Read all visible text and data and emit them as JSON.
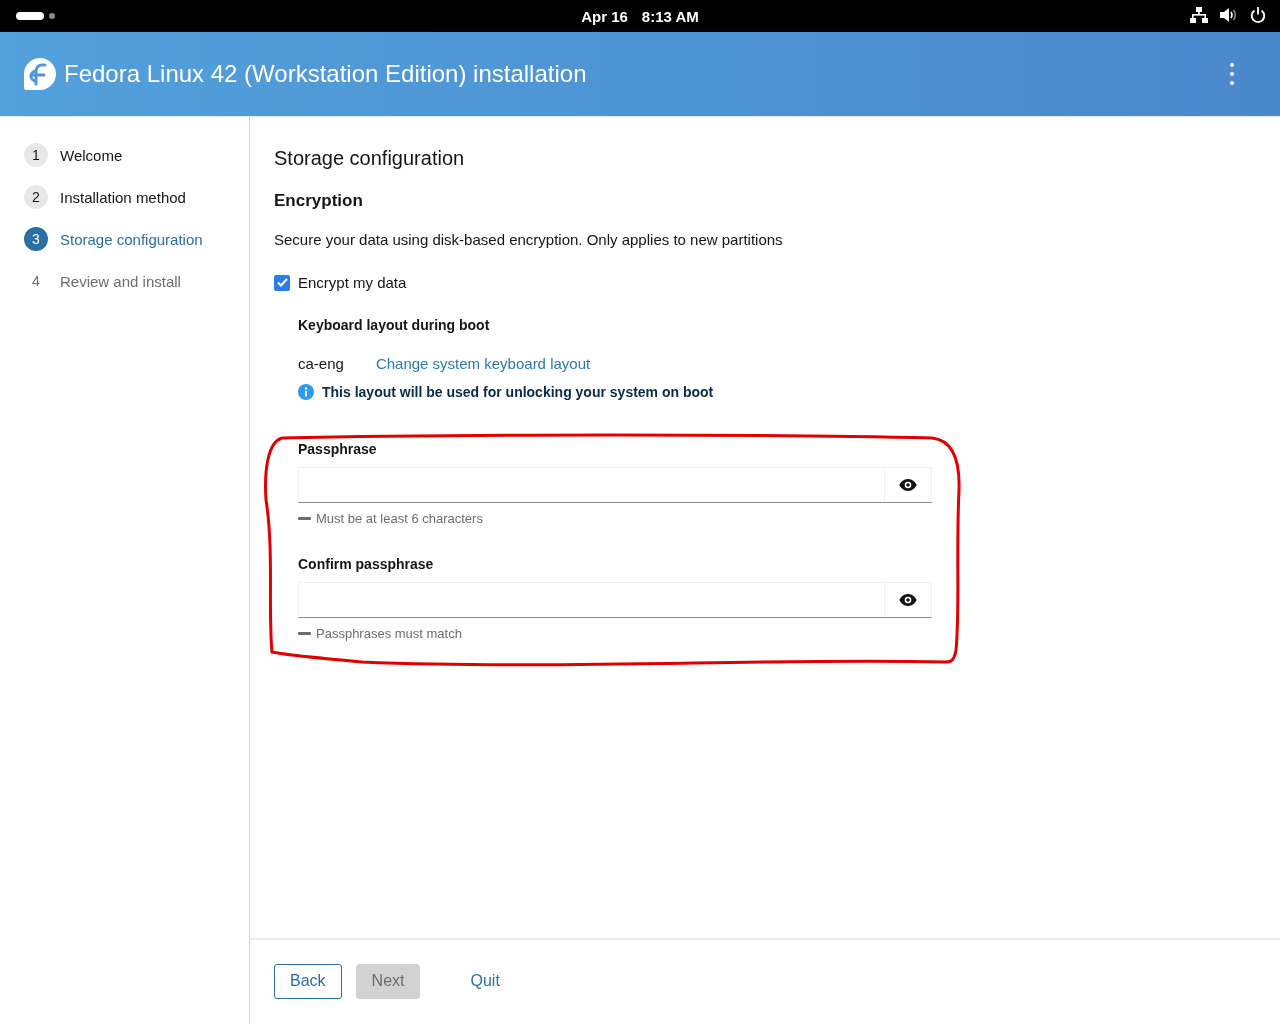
{
  "top_bar": {
    "date": "Apr 16",
    "time": "8:13 AM"
  },
  "header": {
    "title": "Fedora Linux 42 (Workstation Edition) installation"
  },
  "steps": [
    {
      "number": "1",
      "label": "Welcome",
      "selected": false,
      "disabled": false
    },
    {
      "number": "2",
      "label": "Installation method",
      "selected": false,
      "disabled": false
    },
    {
      "number": "3",
      "label": "Storage configuration",
      "selected": true,
      "disabled": false
    },
    {
      "number": "4",
      "label": "Review and install",
      "selected": false,
      "disabled": true
    }
  ],
  "page": {
    "title": "Storage configuration",
    "section": "Encryption",
    "description": "Secure your data using disk-based encryption. Only applies to new partitions",
    "encrypt": {
      "label": "Encrypt my data",
      "checked": true
    },
    "keyboard": {
      "heading": "Keyboard layout during boot",
      "value": "ca-eng",
      "link": "Change system keyboard layout",
      "info": "This layout will be used for unlocking your system on boot"
    },
    "fields": [
      {
        "label": "Passphrase",
        "hint": "Must be at least 6 characters"
      },
      {
        "label": "Confirm passphrase",
        "hint": "Passphrases must match"
      }
    ]
  },
  "annotation": {
    "kind": "outline",
    "color": "#e00000"
  },
  "footer": {
    "buttons": [
      {
        "kind": "secondary",
        "label": "Back",
        "disabled": false
      },
      {
        "kind": "primary",
        "label": "Next",
        "disabled": true
      },
      {
        "kind": "link",
        "label": "Quit",
        "disabled": false
      }
    ]
  }
}
